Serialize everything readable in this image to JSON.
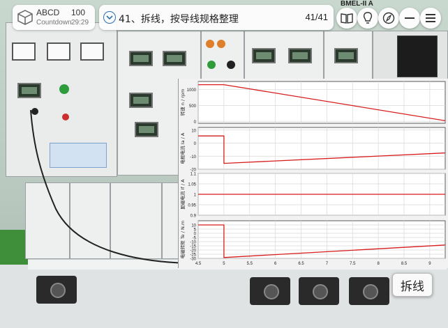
{
  "header": {
    "user_name": "ABCD",
    "score": "100",
    "countdown_label": "Countdown",
    "countdown_time": "29:29",
    "step_title": "41、拆线，按导线规格整理",
    "step_progress": "41/41",
    "equipment_label": "BMEL-II A"
  },
  "toolbar": {
    "book_icon": "book-icon",
    "hint_icon": "lightbulb-icon",
    "compass_icon": "compass-icon",
    "minimize_icon": "minus-icon",
    "menu_icon": "menu-icon"
  },
  "actions": {
    "dismantle_label": "拆线"
  },
  "chart_data": [
    {
      "type": "line",
      "ylabel": "转速 n / rpm",
      "x": [
        4.5,
        5.0,
        9.3
      ],
      "series": [
        {
          "values": [
            1150,
            1150,
            20
          ]
        }
      ],
      "ylim": [
        -60,
        1250
      ],
      "yticks": [
        0,
        500,
        1000
      ],
      "xlim": [
        4.5,
        9.3
      ],
      "grid": true
    },
    {
      "type": "line",
      "ylabel": "电枢电流 Ia / A",
      "x": [
        4.5,
        5.0,
        5.0,
        9.3
      ],
      "series": [
        {
          "values": [
            5.5,
            5.5,
            -15.5,
            -7.5
          ]
        }
      ],
      "ylim": [
        -20,
        12
      ],
      "yticks": [
        -20,
        -10,
        0,
        10
      ],
      "xlim": [
        4.5,
        9.3
      ],
      "grid": true
    },
    {
      "type": "line",
      "ylabel": "励磁电流 If / A",
      "x": [
        4.5,
        9.3
      ],
      "series": [
        {
          "values": [
            1.0,
            1.0
          ]
        }
      ],
      "ylim": [
        0.9,
        1.1
      ],
      "yticks": [
        0.9,
        0.95,
        1,
        1.05,
        1.1
      ],
      "xlim": [
        4.5,
        9.3
      ],
      "grid": true
    },
    {
      "type": "line",
      "ylabel": "电磁转矩 Te / N.m",
      "x": [
        4.5,
        5.0,
        5.0,
        9.3
      ],
      "series": [
        {
          "values": [
            10,
            10,
            -29,
            -14
          ]
        }
      ],
      "ylim": [
        -30,
        15
      ],
      "yticks": [
        -30,
        -25,
        -20,
        -15,
        -10,
        -5,
        0,
        5,
        10
      ],
      "xlim": [
        4.5,
        9.3
      ],
      "xticks": [
        4.5,
        5,
        5.5,
        6,
        6.5,
        7,
        7.5,
        8,
        8.5,
        9,
        9.5
      ],
      "grid": true
    }
  ],
  "colors": {
    "series_line": "#d81b1b",
    "accent": "#2c6fb5"
  }
}
